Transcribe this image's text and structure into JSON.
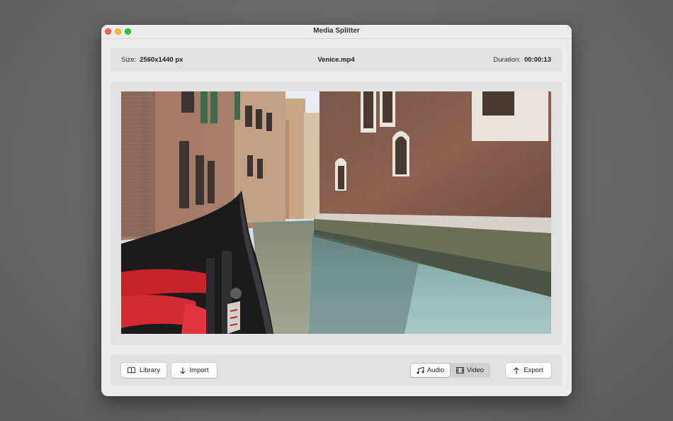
{
  "window": {
    "title": "Media Splitter"
  },
  "info": {
    "size_label": "Size:",
    "size_value": "2560x1440 px",
    "filename": "Venice.mp4",
    "duration_label": "Duration:",
    "duration_value": "00:00:13"
  },
  "preview": {
    "content": "video frame"
  },
  "toolbar": {
    "library_label": "Library",
    "library_icon": "book-icon",
    "import_label": "Import",
    "import_icon": "arrow-down-icon",
    "mode_segments": [
      {
        "label": "Audio",
        "icon": "music-notes-icon",
        "selected": true
      },
      {
        "label": "Video",
        "icon": "film-icon",
        "selected": false
      }
    ],
    "export_label": "Export",
    "export_icon": "arrow-up-icon"
  },
  "colors": {
    "close": "#ff5f57",
    "minimize": "#febc2e",
    "zoom": "#28c840",
    "window_bg": "#ececec",
    "panel_bg": "#e1e1e1"
  }
}
